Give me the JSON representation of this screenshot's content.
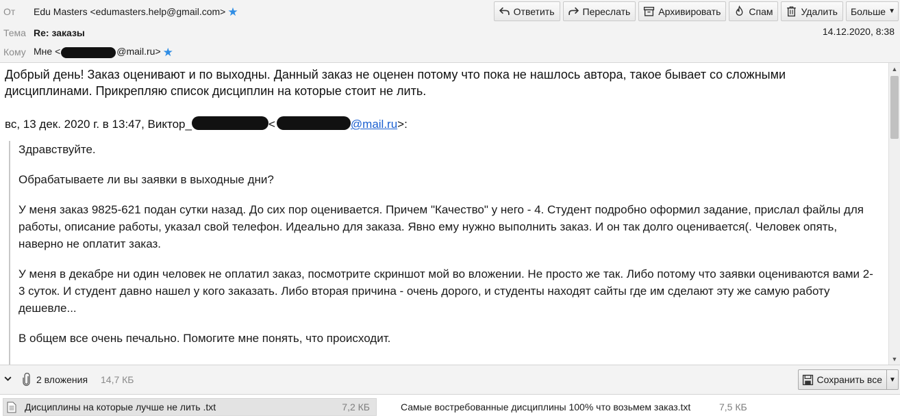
{
  "header": {
    "from_label": "От",
    "from_value": "Edu Masters <edumasters.help@gmail.com>",
    "subject_label": "Тема",
    "subject_value": "Re: заказы",
    "to_label": "Кому",
    "to_prefix": "Мне <",
    "to_suffix": "@mail.ru>",
    "date": "14.12.2020, 8:38",
    "star_color": "#2f8de4"
  },
  "toolbar": {
    "reply": "Ответить",
    "forward": "Переслать",
    "archive": "Архивировать",
    "spam": "Спам",
    "delete": "Удалить",
    "more": "Больше"
  },
  "body": {
    "intro": "Добрый день! Заказ оценивают и по выходны. Данный заказ не оценен потому что пока не нашлось автора, такое бывает со сложными дисциплинами. Прикрепляю список дисциплин на которые стоит не лить.",
    "citation_prefix": "вс, 13 дек. 2020 г. в 13:47, Виктор_",
    "citation_mid": "<",
    "citation_link": "@mail.ru",
    "citation_suffix": ">:",
    "link_color": "#1a5fd0",
    "quote": {
      "p1": "Здравствуйте.",
      "p2": "Обрабатываете ли вы заявки в выходные дни?",
      "p3": "У меня заказ 9825-621  подан сутки назад. До сих пор оценивается. Причем \"Качество\" у него - 4. Студент подробно оформил задание, прислал файлы для работы, описание работы, указал свой телефон. Идеально для заказа. Явно ему нужно выполнить заказ. И он так долго оценивается(. Человек опять, наверно не оплатит заказ.",
      "p4": "У меня в декабре ни один человек не оплатил заказ, посмотрите скриншот мой во вложении. Не просто же так. Либо потому что заявки оцениваются вами 2-3 суток. И студент давно нашел у кого заказать. Либо вторая причина - очень дорого, и студенты находят сайты где им сделают эту же самую работу дешевле...",
      "p5": "В общем все очень печально. Помогите мне понять, что происходит."
    }
  },
  "attachments": {
    "count_label": "2 вложения",
    "total_size": "14,7 КБ",
    "save_all": "Сохранить все",
    "items": [
      {
        "name": "Дисциплины на которые лучше не лить .txt",
        "size": "7,2 КБ"
      },
      {
        "name": "Самые востребованные дисциплины 100% что возьмем заказ.txt",
        "size": "7,5 КБ"
      }
    ]
  }
}
